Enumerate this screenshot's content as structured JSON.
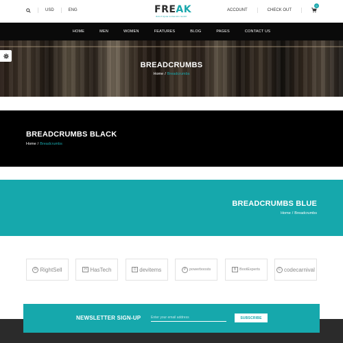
{
  "topbar": {
    "currency": "USD",
    "language": "ENG",
    "account": "ACCOUNT",
    "checkout": "CHECK OUT",
    "cart_count": "0"
  },
  "logo": {
    "name_main": "FRE",
    "name_accent": "AK",
    "tagline": "BOUTIQUE FASHION SHOP"
  },
  "nav": {
    "items": [
      "HOME",
      "MEN",
      "WOMEN",
      "FEATURES",
      "BLOG",
      "PAGES",
      "CONTACT US"
    ]
  },
  "hero": {
    "title": "BREADCRUMBS",
    "crumb_home": "Home",
    "crumb_sep": "/",
    "crumb_current": "Breadcrumbs"
  },
  "black_section": {
    "title": "BREADCRUMBS BLACK",
    "crumb_home": "Home",
    "crumb_sep": "/",
    "crumb_current": "Breadcrumbs"
  },
  "blue_section": {
    "title": "BREADCRUMBS BLUE",
    "crumb_home": "Home",
    "crumb_sep": "/",
    "crumb_current": "Breadcrumbs"
  },
  "brands": [
    {
      "name": "RightSell",
      "icon": "R"
    },
    {
      "name": "HasTech",
      "icon": "H"
    },
    {
      "name": "devitems",
      "icon": "D"
    },
    {
      "name": "powerboosts",
      "icon": "P"
    },
    {
      "name": "BootExperts",
      "icon": "B"
    },
    {
      "name": "codecarnival",
      "icon": "C"
    }
  ],
  "newsletter": {
    "title": "NEWSLETTER SIGN-UP",
    "placeholder": "Enter your email address",
    "button": "SUBSCRIBE"
  },
  "colors": {
    "accent": "#16a8ac",
    "nav_bg": "#0a0a0a",
    "footer_bg": "#2b2b2b"
  }
}
